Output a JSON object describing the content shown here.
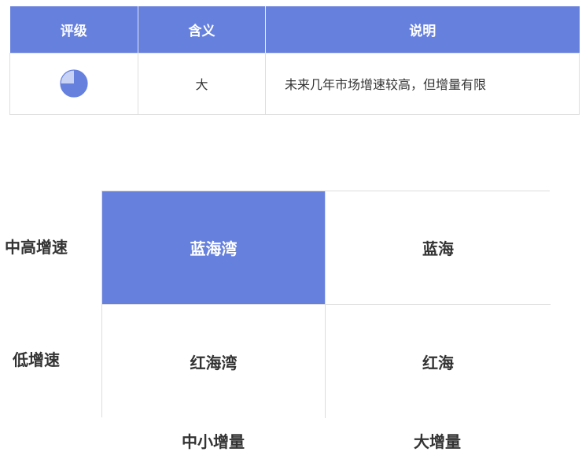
{
  "rating_table": {
    "headers": [
      "评级",
      "含义",
      "说明"
    ],
    "row": {
      "rating_fill_fraction": 0.75,
      "meaning": "大",
      "description": "未来几年市场增速较高，但增量有限"
    }
  },
  "matrix": {
    "row_labels": [
      "中高增速",
      "低增速"
    ],
    "col_labels": [
      "中小增量",
      "大增量"
    ],
    "cells": [
      [
        "蓝海湾",
        "蓝海"
      ],
      [
        "红海湾",
        "红海"
      ]
    ]
  },
  "colors": {
    "accent": "#6680de",
    "pie_light": "#c8d2f4"
  }
}
